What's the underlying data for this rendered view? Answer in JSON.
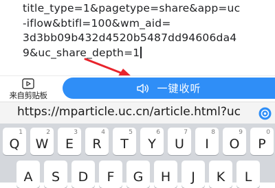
{
  "editor": {
    "lines": [
      "title_type=1&pagetype=share&app=uc",
      "-iflow&btifl=100&wm_aid=",
      "3d3bb09b432d4520b5487dd94606da4",
      "9&uc_share_depth=1"
    ]
  },
  "action_bar": {
    "clipboard_label": "来自剪贴板",
    "clipboard_icon": "clipboard-video-icon",
    "listen_label": "一键收听",
    "listen_icon": "speaker-icon",
    "listen_color": "#2f8ef7"
  },
  "annotation": {
    "color": "#e8242c"
  },
  "suggestion": {
    "url": "https://mparticle.uc.cn/article.html?uc",
    "icon": "browser-icon"
  },
  "keyboard": {
    "row1": [
      {
        "char": "Q",
        "num": "1"
      },
      {
        "char": "W",
        "num": "2"
      },
      {
        "char": "E",
        "num": "3"
      },
      {
        "char": "R",
        "num": "4"
      },
      {
        "char": "T",
        "num": "5"
      },
      {
        "char": "Y",
        "num": "6"
      },
      {
        "char": "U",
        "num": "7"
      },
      {
        "char": "I",
        "num": "8"
      },
      {
        "char": "O",
        "num": "9"
      },
      {
        "char": "P",
        "num": "0"
      }
    ],
    "row2": [
      "A",
      "S",
      "D",
      "F",
      "G",
      "H",
      "J",
      "K",
      "L"
    ]
  }
}
